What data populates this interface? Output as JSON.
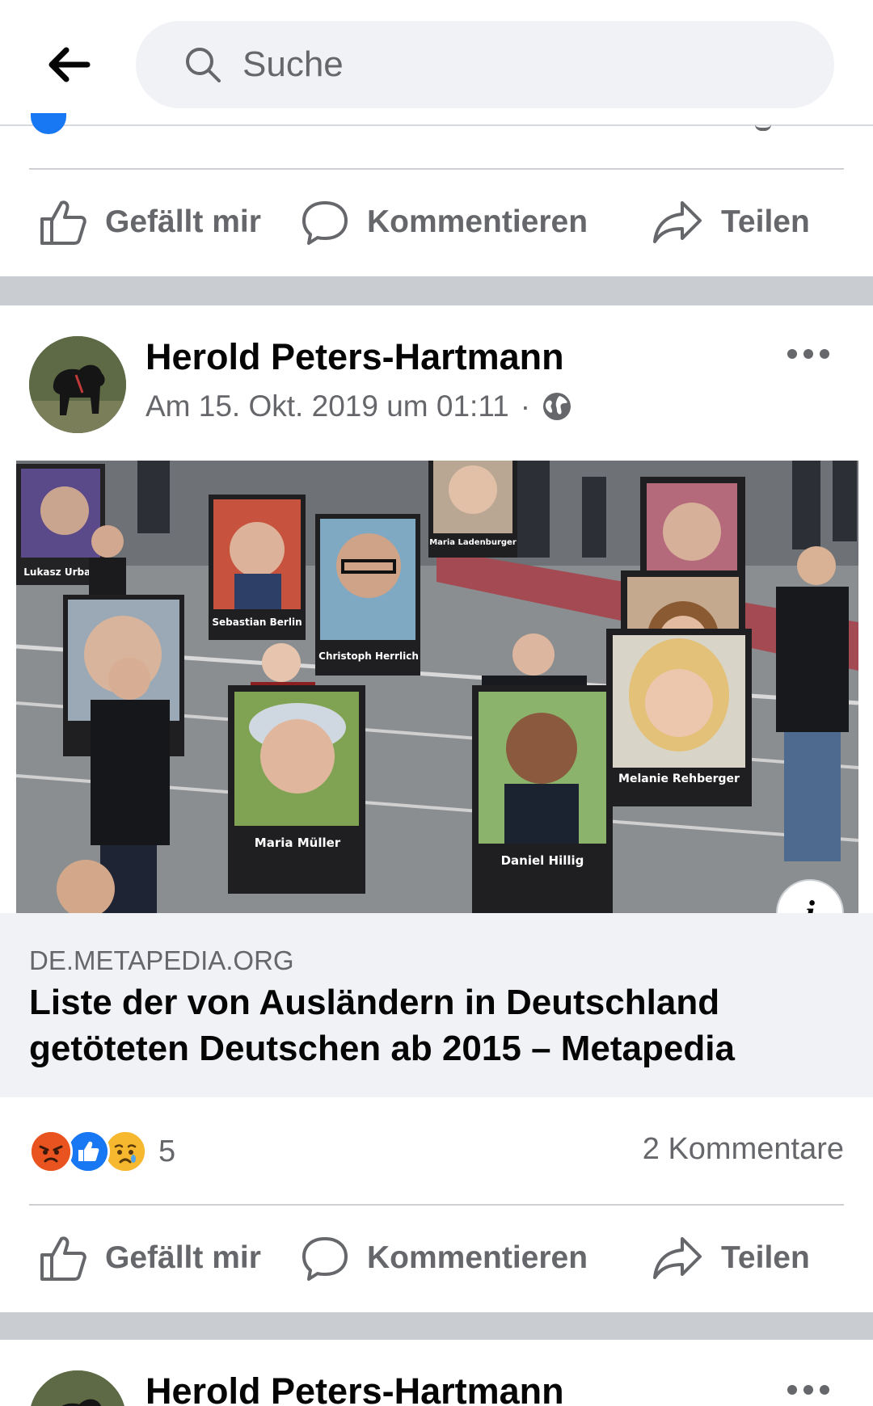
{
  "header": {
    "search_placeholder": "Suche"
  },
  "actions": {
    "like": "Gefällt mir",
    "comment": "Kommentieren",
    "share": "Teilen"
  },
  "post": {
    "author": "Herold Peters-Hartmann",
    "timestamp": "Am 15. Okt. 2019 um 01:11",
    "meta_separator": "·",
    "privacy_icon": "globe-icon",
    "link": {
      "domain": "DE.METAPEDIA.ORG",
      "title": "Liste der von Ausländern in Deutschland getöteten Deutschen ab 2015 – Metapedia"
    },
    "image_signs": [
      "Lukasz Urban",
      "Sebastian Berlin",
      "Christoph Herrlich",
      "Maria Ladenburger",
      "Maria Müller",
      "Daniel Hillig",
      "Melanie Rehberger"
    ],
    "reactions": [
      "angry",
      "like",
      "sad"
    ],
    "reaction_count": "5",
    "comments": "2 Kommentare"
  },
  "next_post": {
    "author": "Herold Peters-Hartmann"
  },
  "colors": {
    "accent": "#1877f2",
    "secondary_text": "#65676b",
    "separator": "#c9ccd1"
  }
}
